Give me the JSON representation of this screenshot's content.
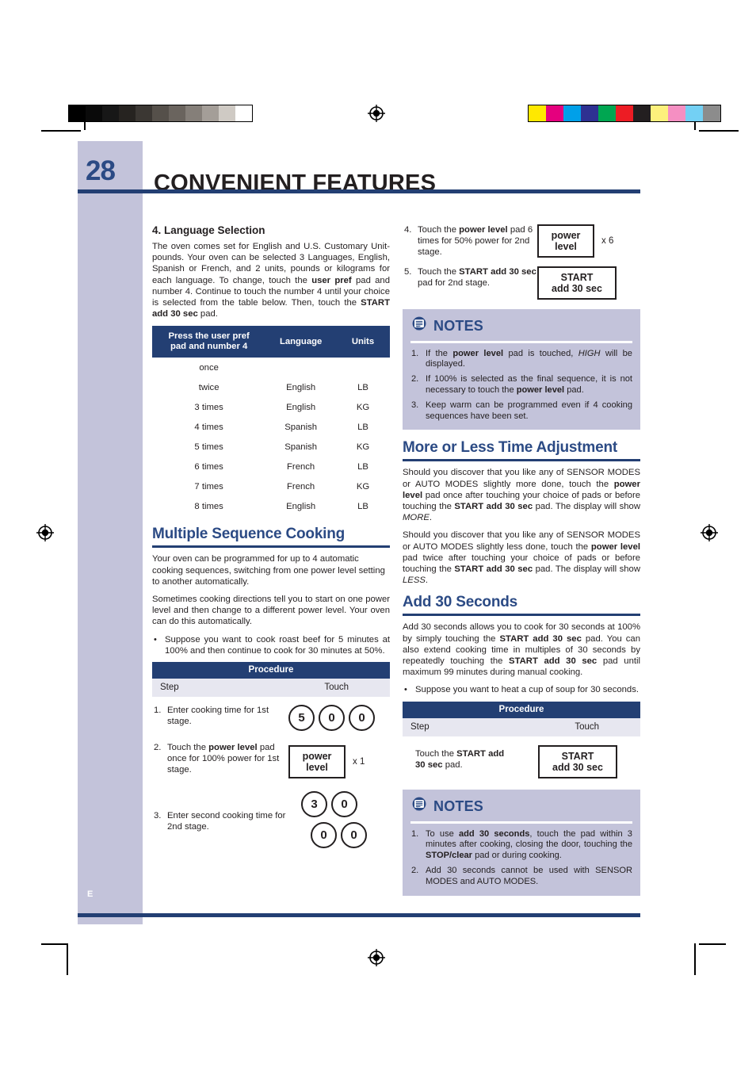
{
  "page": {
    "number": "28",
    "title": "CONVENIENT FEATURES",
    "sidebar_letter": "E",
    "accent_navy": "#233f73",
    "accent_blue": "#2b4a84",
    "lavender": "#c3c3da",
    "lavender_light": "#e7e7f0"
  },
  "left_column": {
    "language_section": {
      "heading": "4. Language Selection",
      "paragraph_html": "The oven comes set for English and U.S. Customary Unit-pounds. Your oven can be selected 3 Languages, English, Spanish or French, and 2 units, pounds or kilograms for each language. To change, touch the <b>user pref</b> pad and number 4. Continue to touch the number 4 until your choice is selected from the table below. Then, touch the <b>START add 30 sec</b> pad.",
      "table": {
        "headers": [
          "Press the user pref pad and number 4",
          "Language",
          "Units"
        ],
        "header_line1": "Press the user pref",
        "header_line2": "pad and number 4",
        "rows": [
          [
            "once",
            "",
            ""
          ],
          [
            "twice",
            "English",
            "LB"
          ],
          [
            "3 times",
            "English",
            "KG"
          ],
          [
            "4 times",
            "Spanish",
            "LB"
          ],
          [
            "5 times",
            "Spanish",
            "KG"
          ],
          [
            "6 times",
            "French",
            "LB"
          ],
          [
            "7 times",
            "French",
            "KG"
          ],
          [
            "8 times",
            "English",
            "LB"
          ]
        ]
      }
    },
    "multiple_sequence": {
      "heading": "Multiple Sequence Cooking",
      "paragraph1": "Your oven can be programmed for up to 4 automatic cooking sequences, switching from one power level setting to another automatically.",
      "paragraph2": "Sometimes cooking directions tell you to start on one power level and then change to a different power level. Your oven can do this automatically.",
      "bullet1": "Suppose you want to cook roast beef for 5 minutes at 100% and then continue to cook for 30 minutes at 50%.",
      "procedure": {
        "title": "Procedure",
        "col_step": "Step",
        "col_touch": "Touch",
        "steps": [
          {
            "num": "1.",
            "text_html": "Enter cooking time for 1st stage.",
            "pads": [
              "5",
              "0",
              "0"
            ]
          },
          {
            "num": "2.",
            "text_html": "Touch the <b>power level</b> pad once for 100% power for 1st stage.",
            "pad_label_line1": "power",
            "pad_label_line2": "level",
            "multiplier": "x 1"
          },
          {
            "num": "3.",
            "text_html": "Enter second cooking time for 2nd stage.",
            "pads_row1": [
              "3",
              "0"
            ],
            "pads_row2": [
              "0",
              "0"
            ]
          }
        ]
      }
    }
  },
  "right_column": {
    "sequence_steps_continued": [
      {
        "num": "4.",
        "text_html": "Touch the <b>power level</b> pad 6 times for 50% power for 2nd stage.",
        "pad_label_line1": "power",
        "pad_label_line2": "level",
        "multiplier": "x 6"
      },
      {
        "num": "5.",
        "text_html": "Touch the <b>START add 30 sec</b> pad for 2nd stage.",
        "pad_label_line1": "START",
        "pad_label_line2": "add 30 sec"
      }
    ],
    "notes_1": {
      "label": "NOTES",
      "items": [
        {
          "num": "1.",
          "text_html": "If the <b>power level</b> pad is touched, <i class=\"it\">HIGH</i> will be displayed."
        },
        {
          "num": "2.",
          "text_html": "If 100% is selected as the final sequence, it is not necessary to touch the <b>power level</b> pad."
        },
        {
          "num": "3.",
          "text_html": "Keep warm can be programmed even if 4 cooking sequences have been set."
        }
      ]
    },
    "more_or_less": {
      "heading": "More or Less Time Adjustment",
      "paragraph1_html": "Should you discover that you like any of SENSOR MODES or AUTO MODES slightly more done, touch the <b>power level</b> pad once after touching your choice of pads or before touching the <b>START add 30 sec</b> pad. The display will show <i class=\"it\">MORE</i>.",
      "paragraph2_html": "Should you discover that you like any of SENSOR MODES or AUTO MODES slightly less done, touch the <b>power level</b> pad twice after touching your choice of pads or before touching the <b>START add 30 sec</b> pad. The display will show <i class=\"it\">LESS</i>."
    },
    "add_30_seconds": {
      "heading": "Add 30 Seconds",
      "paragraph_html": "Add 30 seconds allows you to cook for 30 seconds at 100% by simply touching the <b>START add 30 sec</b> pad. You can also extend cooking time in multiples of 30 seconds by repeatedly touching the <b>START add 30 sec</b> pad until maximum 99 minutes during manual cooking.",
      "bullet1": "Suppose you want to heat a cup of soup for 30 seconds.",
      "procedure": {
        "title": "Procedure",
        "col_step": "Step",
        "col_touch": "Touch",
        "step_text_html": "Touch the <b>START add</b><br><b>30 sec</b> pad.",
        "pad_label_line1": "START",
        "pad_label_line2": "add 30 sec"
      }
    },
    "notes_2": {
      "label": "NOTES",
      "items": [
        {
          "num": "1.",
          "text_html": "To use <b>add 30 seconds</b>, touch the pad within 3 minutes after cooking, closing the door, touching the <b>STOP/clear</b> pad or during cooking."
        },
        {
          "num": "2.",
          "text_html": "Add 30 seconds cannot be used with SENSOR MODES and AUTO MODES."
        }
      ]
    }
  },
  "print_marks": {
    "grayscale_swatches": [
      "#000000",
      "#0a0a0a",
      "#171717",
      "#262320",
      "#3b3733",
      "#55504a",
      "#6a645e",
      "#857f79",
      "#a49e98",
      "#cfcac4",
      "#ffffff"
    ],
    "color_swatches": [
      "#ffe800",
      "#e5007e",
      "#00a0e9",
      "#2e3192",
      "#00a651",
      "#ed1c24",
      "#231f20",
      "#fdf07c",
      "#f58fc2",
      "#73d0f4",
      "#8c8c8c"
    ]
  }
}
